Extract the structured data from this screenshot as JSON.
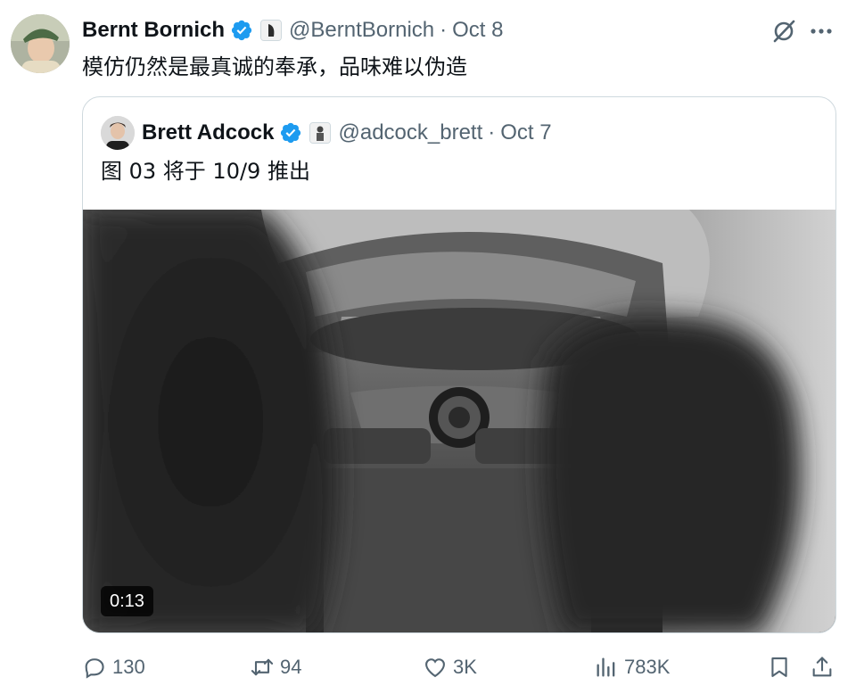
{
  "post": {
    "author_name": "Bernt Bornich",
    "handle": "@BerntBornich",
    "separator": "·",
    "date": "Oct 8",
    "text": "模仿仍然是最真诚的奉承，品味难以伪造"
  },
  "quoted_post": {
    "author_name": "Brett Adcock",
    "handle": "@adcock_brett",
    "separator": "·",
    "date": "Oct 7",
    "text": "图 03 将于 10/9 推出",
    "video_duration": "0:13"
  },
  "actions": {
    "replies": "130",
    "reposts": "94",
    "likes": "3K",
    "views": "783K"
  },
  "colors": {
    "verified": "#1d9bf0",
    "muted_text": "#536471",
    "border": "#cfd9de"
  },
  "icons": [
    "grok-icon",
    "more-icon",
    "verified-badge-icon",
    "reply-icon",
    "repost-icon",
    "like-icon",
    "views-icon",
    "bookmark-icon",
    "share-icon"
  ]
}
